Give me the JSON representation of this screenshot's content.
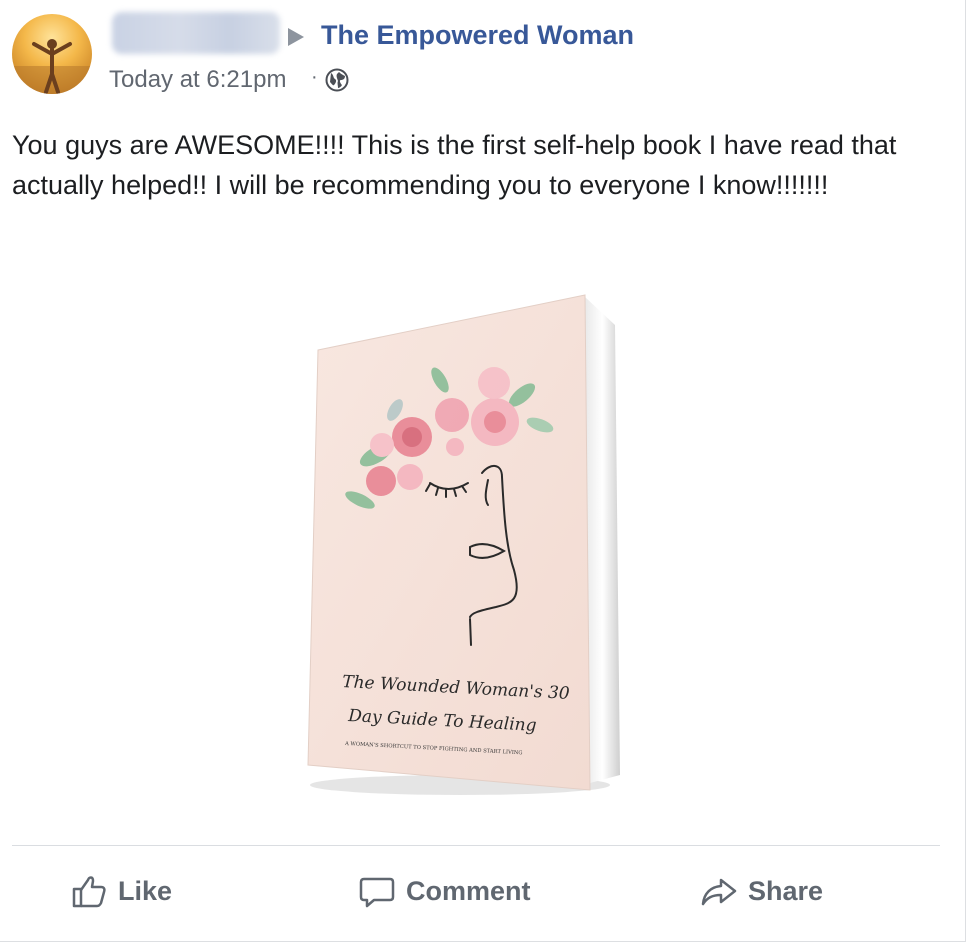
{
  "post": {
    "page_name": "The Empowered Woman",
    "timestamp": "Today at 6:21pm",
    "privacy_separator": "·",
    "privacy_icon": "globe-icon",
    "text": "You guys are AWESOME!!!! This is the first self-help book I have read that actually helped!! I will be recommending you to everyone I know!!!!!!!"
  },
  "book": {
    "title_line1": "The Wounded Woman's 30",
    "title_line2": "Day Guide To Healing",
    "subtitle": "A WOMAN'S SHORTCUT TO STOP FIGHTING AND START LIVING",
    "cover_color": "#f7e4dc",
    "flower_colors": [
      "#e98a97",
      "#f4b6c0",
      "#8fbf9a"
    ]
  },
  "actions": {
    "like": "Like",
    "comment": "Comment",
    "share": "Share"
  },
  "colors": {
    "page_link": "#385898",
    "meta_text": "#616770",
    "action_text": "#606770"
  }
}
